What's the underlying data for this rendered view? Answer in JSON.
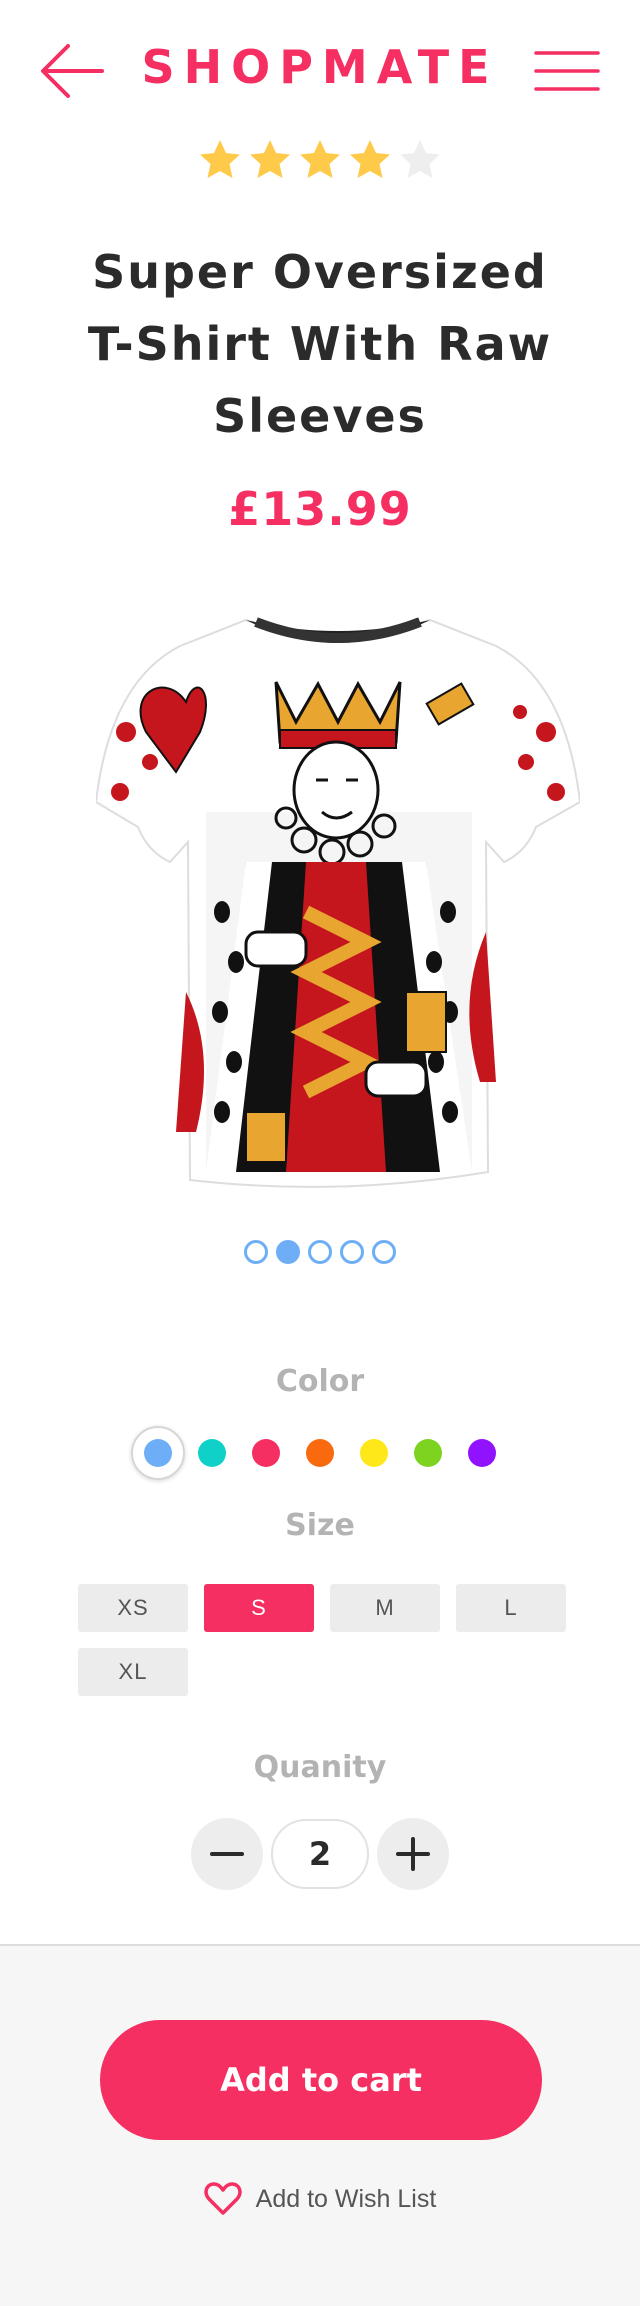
{
  "header": {
    "brand": "SHOPMATE",
    "back_icon": "arrow-left-icon",
    "menu_icon": "hamburger-menu-icon",
    "accent_color": "#f62f63"
  },
  "product": {
    "rating": 4,
    "rating_max": 5,
    "title": "Super Oversized T-Shirt With Raw Sleeves",
    "price": "£13.99",
    "image_icon": "king-of-hearts-tshirt-image",
    "carousel": {
      "count": 5,
      "active_index": 1
    }
  },
  "color": {
    "label": "Color",
    "swatches": [
      "#6eaef7",
      "#10d1c8",
      "#f62f63",
      "#f96a0e",
      "#ffe81a",
      "#7ed321",
      "#9012fe"
    ],
    "selected_index": 0
  },
  "size": {
    "label": "Size",
    "options": [
      "XS",
      "S",
      "M",
      "L",
      "XL"
    ],
    "selected": "S"
  },
  "quantity": {
    "label": "Quanity",
    "value": "2",
    "minus_icon": "minus-icon",
    "plus_icon": "plus-icon"
  },
  "actions": {
    "add_to_cart": "Add to cart",
    "wishlist": "Add to Wish List",
    "wishlist_icon": "heart-icon"
  }
}
